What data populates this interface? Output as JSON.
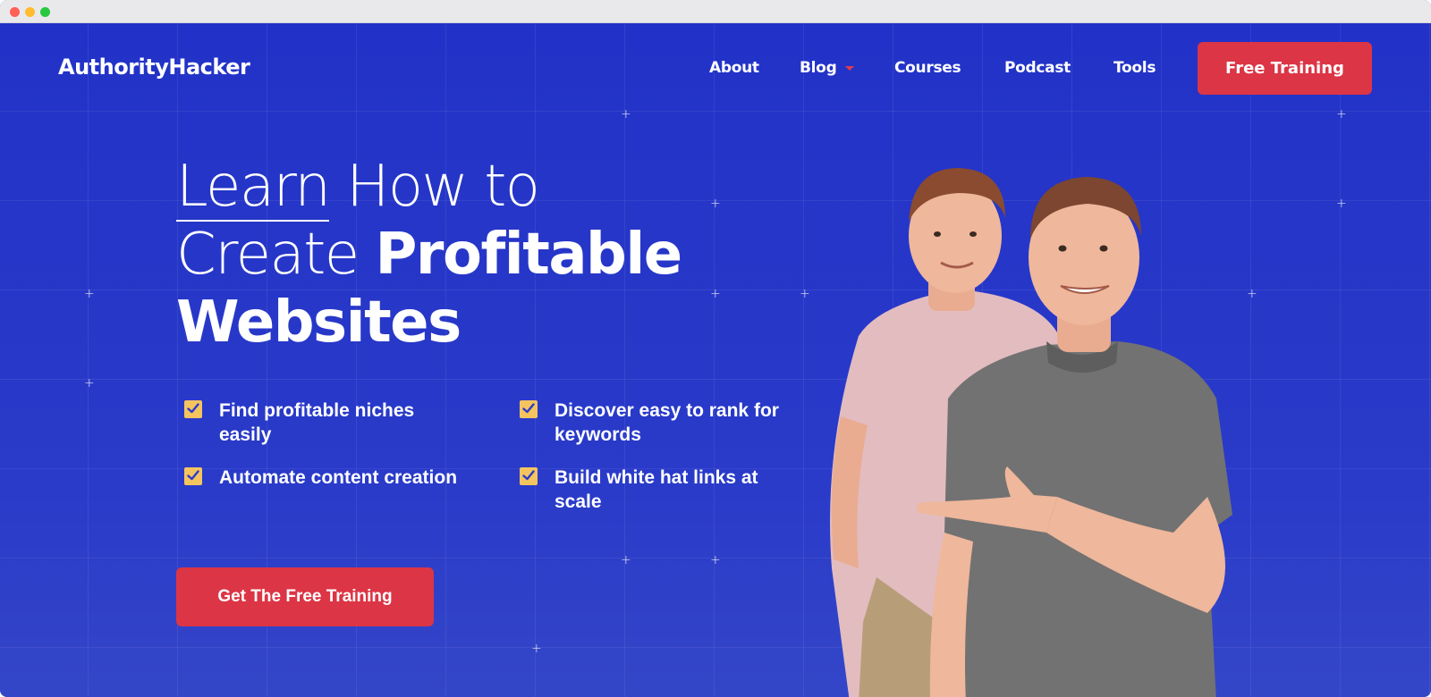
{
  "window": {
    "controls": [
      "close",
      "minimize",
      "maximize"
    ]
  },
  "header": {
    "logo": "AuthorityHacker",
    "nav": [
      {
        "label": "About"
      },
      {
        "label": "Blog",
        "has_dropdown": true
      },
      {
        "label": "Courses"
      },
      {
        "label": "Podcast"
      },
      {
        "label": "Tools"
      }
    ],
    "cta_label": "Free Training"
  },
  "hero": {
    "headline": {
      "word1": "Learn",
      "word2": " How to",
      "word3": "Create ",
      "word4": "Profitable",
      "word5": "Websites"
    },
    "features": [
      "Find profitable niches easily",
      "Discover easy to rank for keywords",
      "Automate content creation",
      "Build white hat links at scale"
    ],
    "cta_label": "Get The Free Training"
  },
  "icons": {
    "check": "checkbox-checked-icon",
    "dropdown": "caret-down-icon"
  },
  "colors": {
    "background": "#2535c6",
    "accent_red": "#dc3545",
    "check_yellow": "#f4c45f",
    "text": "#ffffff"
  }
}
